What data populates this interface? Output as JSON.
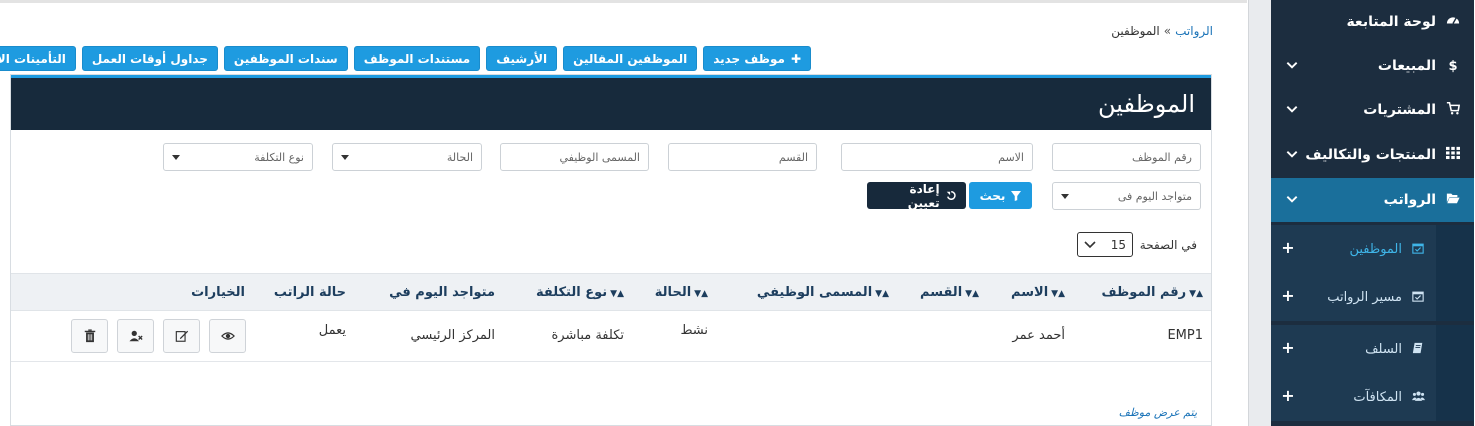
{
  "breadcrumb": {
    "parent": "الرواتب",
    "separator": "»",
    "current": "الموظفين"
  },
  "toolbar": {
    "buttons": [
      {
        "label": "موظف جديد",
        "has_plus": true
      },
      {
        "label": "الموظفين المقالين"
      },
      {
        "label": "الأرشيف"
      },
      {
        "label": "مستندات الموظف"
      },
      {
        "label": "سندات الموظفين"
      },
      {
        "label": "جداول أوقات العمل"
      },
      {
        "label": "التأمينات الاجتماعية"
      }
    ]
  },
  "panel": {
    "title": "الموظفين"
  },
  "filters": {
    "employee_no": {
      "placeholder": "رقم الموظف"
    },
    "name": {
      "placeholder": "الاسم"
    },
    "department": {
      "placeholder": "القسم"
    },
    "job_title": {
      "placeholder": "المسمى الوظيفي"
    },
    "status": {
      "value": "الحالة"
    },
    "cost_type": {
      "value": "نوع التكلفة"
    },
    "present_today": {
      "value": "متواجد اليوم فى"
    },
    "search_label": "بحث",
    "reset_label": "إعادة تعيين"
  },
  "pagination": {
    "per_page_label": "في الصفحة",
    "per_page_value": "15"
  },
  "table": {
    "headers": {
      "employee_no": "رقم الموظف",
      "name": "الاسم",
      "department": "القسم",
      "job_title": "المسمى الوظيفي",
      "status": "الحالة",
      "cost_type": "نوع التكلفة",
      "present_today": "متواجد اليوم في",
      "salary_status": "حالة الراتب",
      "options": "الخيارات"
    },
    "rows": [
      {
        "employee_no": "EMP1",
        "name": "أحمد عمر",
        "department": "",
        "job_title": "",
        "status": "نشط",
        "cost_type": "تكلفة مباشرة",
        "present_today": "المركز الرئيسي",
        "salary_status": "يعمل"
      }
    ]
  },
  "footer_note": "يتم عرض موظف",
  "sidebar": {
    "items": [
      {
        "label": "لوحة المتابعة",
        "icon": "dashboard-icon"
      },
      {
        "label": "المبيعات",
        "icon": "dollar-icon"
      },
      {
        "label": "المشتريات",
        "icon": "cart-icon"
      },
      {
        "label": "المنتجات والتكاليف",
        "icon": "grid-icon"
      },
      {
        "label": "الرواتب",
        "icon": "folder-open-icon",
        "active": true
      }
    ],
    "sub_items": [
      {
        "label": "الموظفين",
        "icon": "calendar-icon",
        "active": true
      },
      {
        "label": "مسير الرواتب",
        "icon": "calendar-icon"
      },
      {
        "label": "السلف",
        "icon": "book-icon"
      },
      {
        "label": "المكافآت",
        "icon": "users-icon"
      }
    ]
  },
  "colors": {
    "accent": "#1e9be0",
    "sidebar_bg": "#1c2d3f",
    "panel_header": "#172a3c",
    "active_item": "#1a6f9b"
  }
}
